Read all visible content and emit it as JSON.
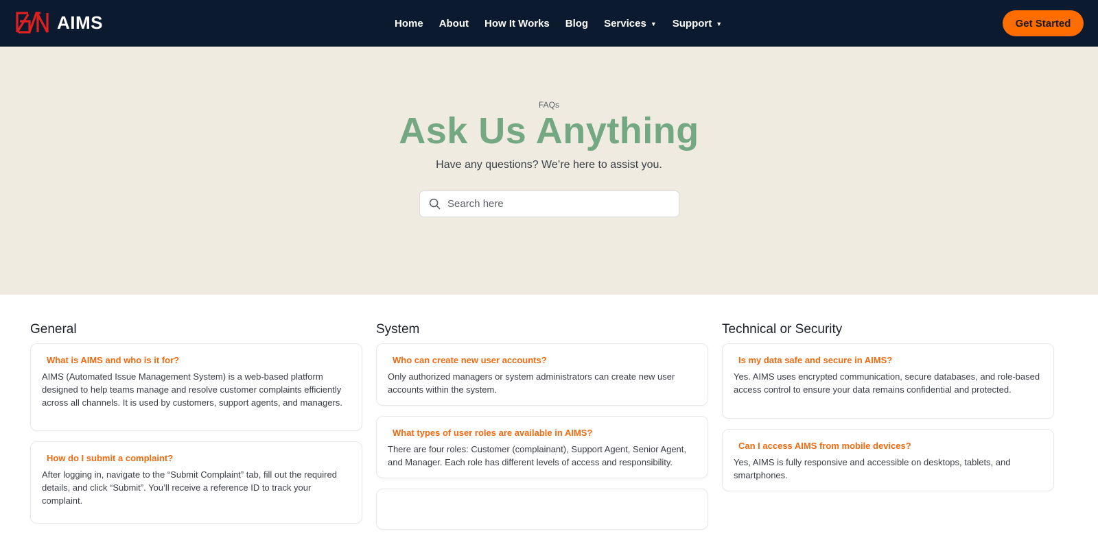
{
  "header": {
    "brand_name": "AIMS",
    "nav": [
      {
        "label": "Home",
        "has_caret": false
      },
      {
        "label": "About",
        "has_caret": false
      },
      {
        "label": "How It Works",
        "has_caret": false
      },
      {
        "label": "Blog",
        "has_caret": false
      },
      {
        "label": "Services",
        "has_caret": true
      },
      {
        "label": "Support",
        "has_caret": true
      }
    ],
    "cta_label": "Get Started"
  },
  "hero": {
    "eyebrow": "FAQs",
    "title": "Ask Us Anything",
    "subtitle": "Have any questions? We’re here to assist you.",
    "search_placeholder": "Search here",
    "search_value": ""
  },
  "faq": [
    {
      "title": "General",
      "items": [
        {
          "q": "What is AIMS and who is it for?",
          "a": "AIMS (Automated Issue Management System) is a web-based platform designed to help teams manage and resolve customer complaints efficiently across all channels. It is used by customers, support agents, and managers."
        },
        {
          "q": "How do I submit a complaint?",
          "a": "After logging in, navigate to the “Submit Complaint” tab, fill out the required details, and click “Submit”. You’ll receive a reference ID to track your complaint."
        }
      ]
    },
    {
      "title": "System",
      "items": [
        {
          "q": "Who can create new user accounts?",
          "a": "Only authorized managers or system administrators can create new user accounts within the system."
        },
        {
          "q": "What types of user roles are available in AIMS?",
          "a": "There are four roles: Customer (complainant), Support Agent, Senior Agent, and Manager. Each role has different levels of access and responsibility."
        },
        {
          "q": "",
          "a": ""
        }
      ]
    },
    {
      "title": "Technical or Security",
      "items": [
        {
          "q": "Is my data safe and secure in AIMS?",
          "a": "Yes. AIMS uses encrypted communication, secure databases, and role-based access control to ensure your data remains confidential and protected."
        },
        {
          "q": "Can I access AIMS from mobile devices?",
          "a": "Yes, AIMS is fully responsive and accessible on desktops, tablets, and smartphones."
        }
      ]
    }
  ],
  "colors": {
    "header_bg": "#0c1a2f",
    "accent_orange": "#ff6d00",
    "hero_bg": "#efebe1",
    "hero_title": "#74a883",
    "logo_red": "#e02020"
  },
  "icons": {
    "logo": "aims-logo-icon",
    "search": "search-icon",
    "caret": "chevron-down-icon"
  }
}
